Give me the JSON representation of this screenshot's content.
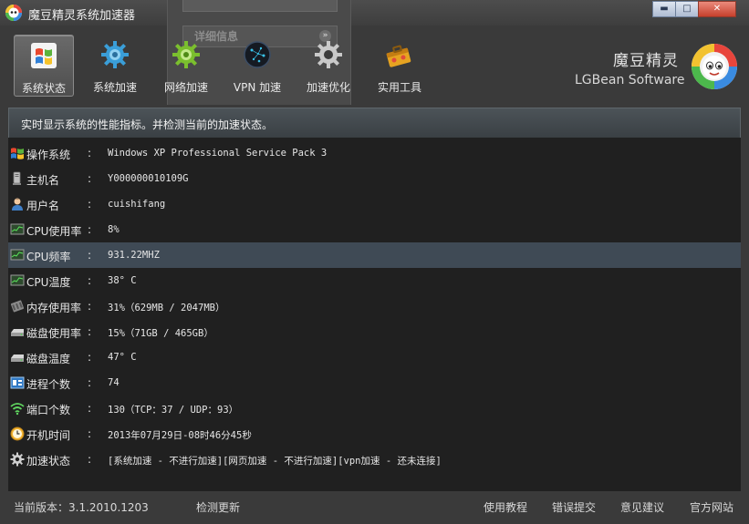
{
  "window": {
    "title": "魔豆精灵系统加速器",
    "controls": {
      "minimize": "▬",
      "maximize": "□",
      "close": "✕"
    }
  },
  "background_panel": {
    "title": "详细信息",
    "chevron": "»"
  },
  "toolbar": {
    "items": [
      {
        "label": "系统状态",
        "icon": "windows-flag-icon",
        "active": true
      },
      {
        "label": "系统加速",
        "icon": "blue-gear-icon",
        "active": false
      },
      {
        "label": "网络加速",
        "icon": "green-gear-icon",
        "active": false
      },
      {
        "label": "VPN 加速",
        "icon": "vpn-globe-icon",
        "active": false
      },
      {
        "label": "加速优化",
        "icon": "gray-gear-icon",
        "active": false
      },
      {
        "label": "实用工具",
        "icon": "toolbox-icon",
        "active": false
      }
    ]
  },
  "brand": {
    "name_cn": "魔豆精灵",
    "name_en": "LGBean Software"
  },
  "banner": {
    "text": "实时显示系统的性能指标。并检测当前的加速状态。"
  },
  "rows": [
    {
      "icon": "windows-icon",
      "label": "操作系统",
      "colon": ":",
      "value": "Windows XP Professional Service Pack 3"
    },
    {
      "icon": "computer-icon",
      "label": "主机名",
      "colon": ":",
      "value": "Y000000010109G"
    },
    {
      "icon": "user-icon",
      "label": "用户名",
      "colon": ":",
      "value": "cuishifang"
    },
    {
      "icon": "cpu-monitor-icon",
      "label": "CPU使用率",
      "colon": ":",
      "value": "8%"
    },
    {
      "icon": "cpu-monitor-icon",
      "label": "CPU频率",
      "colon": ":",
      "value": "931.22MHZ"
    },
    {
      "icon": "cpu-monitor-icon",
      "label": "CPU温度",
      "colon": ":",
      "value": "38° C"
    },
    {
      "icon": "memory-icon",
      "label": "内存使用率",
      "colon": ":",
      "value": "31%（629MB / 2047MB）"
    },
    {
      "icon": "disk-icon",
      "label": "磁盘使用率",
      "colon": ":",
      "value": "15%（71GB / 465GB）"
    },
    {
      "icon": "disk-icon",
      "label": "磁盘温度",
      "colon": ":",
      "value": "47° C"
    },
    {
      "icon": "process-icon",
      "label": "进程个数",
      "colon": ":",
      "value": "74"
    },
    {
      "icon": "wifi-icon",
      "label": "端口个数",
      "colon": ":",
      "value": "130（TCP：37 / UDP：93）"
    },
    {
      "icon": "clock-icon",
      "label": "开机时间",
      "colon": ":",
      "value": "2013年07月29日-08时46分45秒"
    },
    {
      "icon": "settings-gear-icon",
      "label": "加速状态",
      "colon": ":",
      "value": "[系统加速 - 不进行加速][网页加速 - 不进行加速][vpn加速 - 还未连接]"
    }
  ],
  "highlighted_row": "CPU频率",
  "footer": {
    "version": "当前版本：3.1.2010.1203",
    "check_update": "检测更新",
    "tutorial": "使用教程",
    "report_error": "错误提交",
    "feedback": "意见建议",
    "website": "官方网站"
  }
}
